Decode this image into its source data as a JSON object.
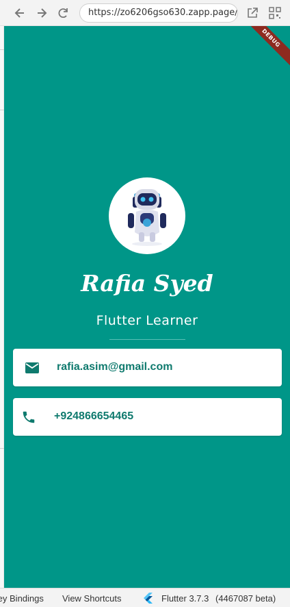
{
  "browser": {
    "url": "https://zo6206gso630.zapp.page/",
    "back_icon": "arrow-left-icon",
    "forward_icon": "arrow-right-icon",
    "reload_icon": "reload-icon",
    "open_external_icon": "open-external-icon",
    "qr_icon": "qr-code-icon"
  },
  "app": {
    "debug_banner": "DEBUG",
    "name": "Rafia Syed",
    "title": "Flutter Learner",
    "email": "rafia.asim@gmail.com",
    "phone": "+924866654465",
    "bg_color": "#009688",
    "accent_color": "#0f7a6e"
  },
  "footer": {
    "key_bindings": "Key Bindings",
    "view_shortcuts": "View Shortcuts",
    "flutter_version": "Flutter 3.7.3",
    "build": "(4467087 beta)"
  }
}
